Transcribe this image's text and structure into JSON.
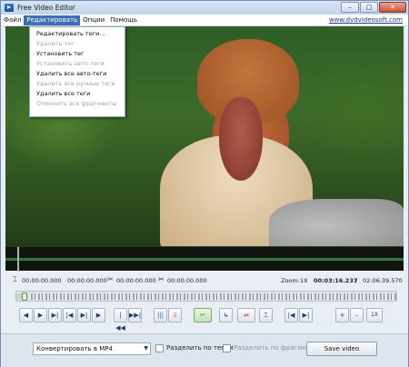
{
  "window": {
    "title": "Free Video Editor",
    "controls": {
      "minimize": "–",
      "maximize": "□",
      "close": "✕"
    }
  },
  "menubar": {
    "items": [
      "Файл",
      "Редактировать",
      "Опции",
      "Помощь"
    ],
    "active_index": 1,
    "site_link": "www.dvdvideosoft.com"
  },
  "edit_menu": {
    "items": [
      {
        "label": "Редактировать теги...",
        "enabled": true
      },
      {
        "label": "Удалить тег",
        "enabled": false
      },
      {
        "label": "Установить тег",
        "enabled": true
      },
      {
        "label": "Установить авто-теги",
        "enabled": false
      },
      {
        "label": "Удалить все авто-теги",
        "enabled": true
      },
      {
        "label": "Удалить все ручные теги",
        "enabled": false
      },
      {
        "label": "Удалить все теги",
        "enabled": true
      },
      {
        "label": "Отменить все фрагменты",
        "enabled": false
      }
    ]
  },
  "times": {
    "start": "00:00:00.000",
    "end": "00:00:00.000",
    "frag_start": "00:00:00.000",
    "frag_end": "00:00:00.000",
    "zoom_label": "Zoom:",
    "zoom_value": "1X",
    "current": "00:03:16.237",
    "separator": "/",
    "total": "02:06:39.570"
  },
  "timeline": {
    "played_fraction": 0.03
  },
  "toolbar": {
    "buttons": [
      {
        "icon": "step-back-icon",
        "glyph": "◀"
      },
      {
        "icon": "play-icon",
        "glyph": "▶"
      },
      {
        "icon": "play-pause-icon",
        "glyph": "▶|"
      },
      {
        "icon": "prev-frame-icon",
        "glyph": "|◀"
      },
      {
        "icon": "next-frame-icon",
        "glyph": "▶|"
      },
      {
        "icon": "forward-icon",
        "glyph": "▶"
      },
      {
        "icon": "go-start-icon",
        "glyph": "|◀◀"
      },
      {
        "icon": "go-end-icon",
        "glyph": "▶▶|"
      },
      {
        "icon": "markers-icon",
        "glyph": "|||"
      },
      {
        "icon": "download-marker-icon",
        "glyph": "⇩"
      },
      {
        "icon": "scissors-icon",
        "glyph": "✂"
      },
      {
        "icon": "return-icon",
        "glyph": "↳"
      },
      {
        "icon": "cut-fragment-icon",
        "glyph": "⇌"
      },
      {
        "icon": "trim-icon",
        "glyph": "⌶"
      },
      {
        "icon": "prev-marker-icon",
        "glyph": "|◀"
      },
      {
        "icon": "next-marker-icon",
        "glyph": "▶|"
      },
      {
        "icon": "zoom-in-icon",
        "glyph": "+"
      },
      {
        "icon": "zoom-out-icon",
        "glyph": "–"
      },
      {
        "icon": "zoom-reset-icon",
        "glyph": "1X"
      }
    ]
  },
  "bottom": {
    "format": "Конвертировать в MP4",
    "split_by_tags": "Разделить по тегам",
    "split_by_fragments": "Разделить по фрагментам",
    "save_button": "Save video"
  }
}
